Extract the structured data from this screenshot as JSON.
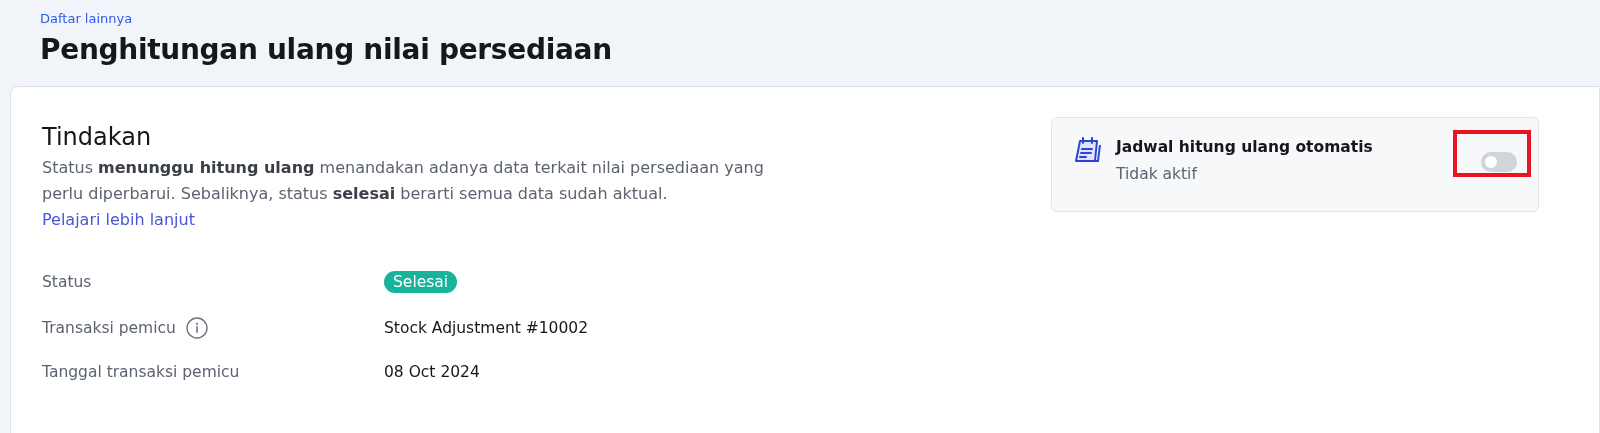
{
  "header": {
    "breadcrumb": "Daftar lainnya",
    "title": "Penghitungan ulang nilai persediaan"
  },
  "section": {
    "title": "Tindakan",
    "description": "Status **menunggu hitung ulang** menandakan adanya data terkait nilai persediaan yang perlu diperbarui. Sebaliknya, status **selesai** berarti semua data sudah aktual.",
    "link": "Pelajari lebih lanjut"
  },
  "schedule": {
    "title": "Jadwal hitung ulang otomatis",
    "status": "Tidak aktif",
    "on": false,
    "highlighted": true
  },
  "details": [
    {
      "label": "Status",
      "kind": "badge",
      "value": "Selesai"
    },
    {
      "label": "Transaksi pemicu",
      "kind": "text",
      "value": "Stock Adjustment #10002",
      "info": true
    },
    {
      "label": "Tanggal transaksi pemicu",
      "kind": "text",
      "value": "08 Oct 2024"
    }
  ]
}
